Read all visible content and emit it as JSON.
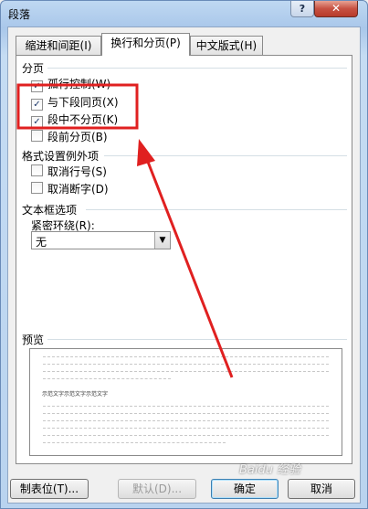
{
  "window": {
    "title": "段落",
    "help_label": "?",
    "close_label": "✕"
  },
  "tabs": [
    {
      "label": "缩进和间距(I)"
    },
    {
      "label": "换行和分页(P)"
    },
    {
      "label": "中文版式(H)"
    }
  ],
  "pagination": {
    "heading": "分页",
    "items": [
      {
        "label": "孤行控制(W)",
        "checked": true
      },
      {
        "label": "与下段同页(X)",
        "checked": true
      },
      {
        "label": "段中不分页(K)",
        "checked": true
      },
      {
        "label": "段前分页(B)",
        "checked": false
      }
    ]
  },
  "format_exceptions": {
    "heading": "格式设置例外项",
    "items": [
      {
        "label": "取消行号(S)",
        "checked": false
      },
      {
        "label": "取消断字(D)",
        "checked": false
      }
    ]
  },
  "textbox": {
    "heading": "文本框选项",
    "wrap_label": "紧密环绕(R):",
    "wrap_value": "无"
  },
  "preview": {
    "heading": "预览",
    "sample_text": "示范文字示范文字示范文字"
  },
  "buttons": {
    "tabs_label": "制表位(T)...",
    "default_label": "默认(D)...",
    "ok_label": "确定",
    "cancel_label": "取消"
  },
  "watermark": "Baidu 经验",
  "colors": {
    "annotation": "#e02020",
    "accent": "#3c7fb1"
  }
}
